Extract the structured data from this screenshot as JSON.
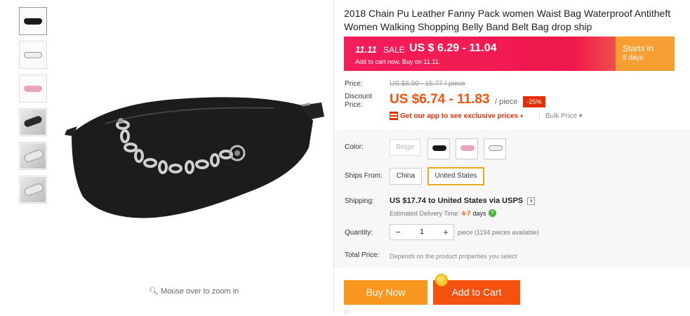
{
  "product": {
    "title": "2018 Chain Pu Leather Fanny Pack women Waist Bag Waterproof Antitheft Women Walking Shopping Belly Band Belt Bag drop ship"
  },
  "thumbnails": [
    {
      "name": "thumb-black-bag"
    },
    {
      "name": "thumb-white-bag"
    },
    {
      "name": "thumb-pink-bag"
    },
    {
      "name": "thumb-chain-detail"
    },
    {
      "name": "thumb-white-detail"
    },
    {
      "name": "thumb-interior"
    }
  ],
  "zoom_hint": "Mouse over to zoom in",
  "sale_banner": {
    "event": "11.11",
    "sale_label": "SALE",
    "price": "US $ 6.29 - 11.04",
    "subtitle": "Add to cart now. Buy on 11.11.",
    "starts_in": "Starts in",
    "days": "6 days"
  },
  "pricing": {
    "price_label": "Price:",
    "original_price": "US $8.99 - 15.77 / piece",
    "discount_label_1": "Discount",
    "discount_label_2": "Price:",
    "discount_price": "US $6.74 - 11.83",
    "per_piece": "/ piece",
    "discount_badge": "-25%",
    "app_text_1": "Get our app to see",
    "app_text_2": "exclusive prices",
    "bulk_price": "Bulk Price ▾"
  },
  "options": {
    "color_label": "Color:",
    "colors": [
      "Beige",
      "Black",
      "Pink",
      "White"
    ],
    "color_hex": {
      "black": "#1a1a1a",
      "pink": "#e8a5b8",
      "white": "#eeeeee"
    },
    "ships_from_label": "Ships From:",
    "ships_from": [
      "China",
      "United States"
    ],
    "ships_from_selected": "United States"
  },
  "shipping": {
    "label": "Shipping:",
    "cost": "US $17.74",
    "to_text": "to United States via USPS",
    "eta_label": "Estimated Delivery Time:",
    "eta_days": "4-7",
    "eta_unit": "days"
  },
  "quantity": {
    "label": "Quantity:",
    "value": "1",
    "info": "piece (1194 pieces available)"
  },
  "total": {
    "label": "Total Price:",
    "info": "Depends on the product properties you select"
  },
  "actions": {
    "buy_now": "Buy Now",
    "add_to_cart": "Add to Cart"
  },
  "colors": {
    "accent_orange": "#f5510f",
    "buy_now": "#f8961e",
    "banner_red": "#f51d5a",
    "banner_orange": "#f6a033"
  }
}
